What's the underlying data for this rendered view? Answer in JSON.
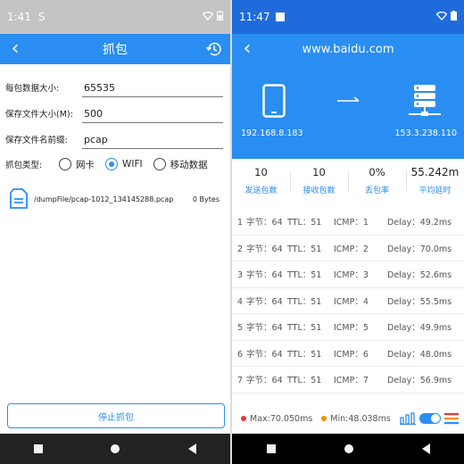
{
  "left": {
    "status": {
      "time": "1:41",
      "s_icon": "S"
    },
    "appbar": {
      "back": "‹",
      "title": "抓包"
    },
    "form": {
      "packet_size_label": "每包数据大小:",
      "packet_size_value": "65535",
      "file_size_label": "保存文件大小(M):",
      "file_size_value": "500",
      "prefix_label": "保存文件名前缀:",
      "prefix_value": "pcap",
      "type_label": "抓包类型:",
      "types": [
        "网卡",
        "WIFI",
        "移动数据"
      ],
      "selected_type": "WIFI"
    },
    "file": {
      "name": "/dumpFile/pcap-1012_134145288.pcap",
      "size": "0 Bytes"
    },
    "stop_button": "停止抓包"
  },
  "right": {
    "status": {
      "time": "11:47"
    },
    "appbar": {
      "back": "‹",
      "title": "www.baidu.com"
    },
    "local_ip": "192.168.8.183",
    "remote_ip": "153.3.238.110",
    "stats": [
      {
        "value": "10",
        "label": "发送包数"
      },
      {
        "value": "10",
        "label": "接收包数"
      },
      {
        "value": "0%",
        "label": "丢包率"
      },
      {
        "value": "55.242m",
        "label": "平均延时"
      }
    ],
    "rows": [
      {
        "seq": "1",
        "bytes": "字节：64",
        "ttl": "TTL：51",
        "icmp": "ICMP：1",
        "delay": "Delay：49.2ms"
      },
      {
        "seq": "2",
        "bytes": "字节：64",
        "ttl": "TTL：51",
        "icmp": "ICMP：2",
        "delay": "Delay：70.0ms"
      },
      {
        "seq": "3",
        "bytes": "字节：64",
        "ttl": "TTL：51",
        "icmp": "ICMP：3",
        "delay": "Delay：52.6ms"
      },
      {
        "seq": "4",
        "bytes": "字节：64",
        "ttl": "TTL：51",
        "icmp": "ICMP：4",
        "delay": "Delay：55.5ms"
      },
      {
        "seq": "5",
        "bytes": "字节：64",
        "ttl": "TTL：51",
        "icmp": "ICMP：5",
        "delay": "Delay：49.9ms"
      },
      {
        "seq": "6",
        "bytes": "字节：64",
        "ttl": "TTL：51",
        "icmp": "ICMP：6",
        "delay": "Delay：48.0ms"
      },
      {
        "seq": "7",
        "bytes": "字节：64",
        "ttl": "TTL：51",
        "icmp": "ICMP：7",
        "delay": "Delay：56.9ms"
      }
    ],
    "footer": {
      "max": "Max:70.050ms",
      "min": "Min:48.038ms"
    }
  },
  "colors": {
    "primary": "#2a8df2",
    "status_right": "#1f6bdc",
    "max_dot": "#e53935",
    "min_dot": "#fb8c00"
  },
  "icons": [
    "back-icon",
    "history-icon",
    "wifi-icon",
    "battery-icon",
    "file-icon",
    "phone-icon",
    "arrow-right-icon",
    "server-icon",
    "bar-chart-icon",
    "toggle-icon",
    "menu-icon"
  ]
}
